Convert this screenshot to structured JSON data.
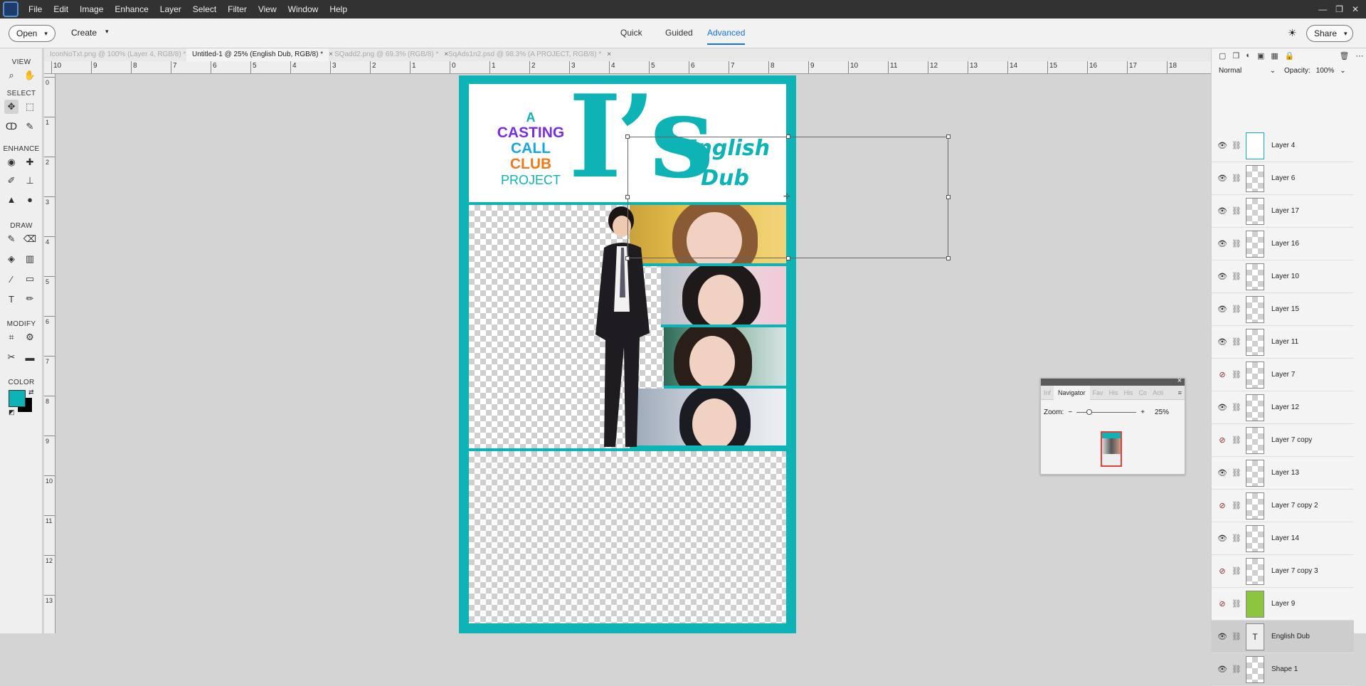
{
  "menubar": {
    "items": [
      "File",
      "Edit",
      "Image",
      "Enhance",
      "Layer",
      "Select",
      "Filter",
      "View",
      "Window",
      "Help"
    ],
    "window_controls": [
      "—",
      "❐",
      "✕"
    ]
  },
  "modebar": {
    "open_label": "Open",
    "create_label": "Create",
    "tabs": [
      "Quick",
      "Guided",
      "Advanced"
    ],
    "share_label": "Share"
  },
  "doc_tabs": [
    {
      "label": "IconNoTxt.png @ 100% (Layer 4, RGB/8) *",
      "active": false
    },
    {
      "label": "Untitled-1 @ 25% (English  Dub, RGB/8) *",
      "active": true
    },
    {
      "label": "SQadd2.png @ 69.3% (RGB/8) *",
      "active": false
    },
    {
      "label": "SqAds1n2.psd @ 98.3% (A    PROJECT, RGB/8) *",
      "active": false
    }
  ],
  "ruler_top": [
    "10",
    "9",
    "8",
    "7",
    "6",
    "5",
    "4",
    "3",
    "2",
    "1",
    "0",
    "1",
    "2",
    "3",
    "4",
    "5",
    "6",
    "7",
    "8",
    "9",
    "10",
    "11",
    "12",
    "13",
    "14",
    "15",
    "16",
    "17",
    "18"
  ],
  "ruler_left": [
    "0",
    "1",
    "2",
    "3",
    "4",
    "5",
    "6",
    "7",
    "8",
    "9",
    "10",
    "11",
    "12",
    "13"
  ],
  "toolbox": {
    "sections": [
      "VIEW",
      "SELECT",
      "ENHANCE",
      "DRAW",
      "MODIFY",
      "COLOR"
    ],
    "foreground_color": "#0eb3b6",
    "background_color": "#000000"
  },
  "poster": {
    "ccc_line1": "A",
    "ccc_line2": "CASTING",
    "ccc_line3": "CALL",
    "ccc_line4": "CLUB",
    "ccc_line5": "PROJECT",
    "title": "I’s",
    "subtitle_line1": "English",
    "subtitle_line2": "Dub",
    "accent_color": "#0eb3b6"
  },
  "navigator": {
    "tabs": [
      "Inf",
      "Navigator",
      "Fav",
      "His",
      "His",
      "Co",
      "Acti"
    ],
    "zoom_label": "Zoom:",
    "zoom_value": "25%"
  },
  "layers": {
    "blend_mode": "Normal",
    "opacity_label": "Opacity:",
    "opacity_value": "100%",
    "items": [
      {
        "name": "Layer 4",
        "visible": true
      },
      {
        "name": "Layer 6",
        "visible": true
      },
      {
        "name": "Layer 17",
        "visible": true
      },
      {
        "name": "Layer 16",
        "visible": true
      },
      {
        "name": "Layer 10",
        "visible": true
      },
      {
        "name": "Layer 15",
        "visible": true
      },
      {
        "name": "Layer 11",
        "visible": true
      },
      {
        "name": "Layer 7",
        "visible": false
      },
      {
        "name": "Layer 12",
        "visible": true
      },
      {
        "name": "Layer 7 copy",
        "visible": false
      },
      {
        "name": "Layer 13",
        "visible": true
      },
      {
        "name": "Layer 7 copy 2",
        "visible": false
      },
      {
        "name": "Layer 14",
        "visible": true
      },
      {
        "name": "Layer 7 copy 3",
        "visible": false
      },
      {
        "name": "Layer 9",
        "visible": false
      },
      {
        "name": "English Dub",
        "visible": true,
        "selected": true
      },
      {
        "name": "Shape 1",
        "visible": true
      }
    ]
  }
}
